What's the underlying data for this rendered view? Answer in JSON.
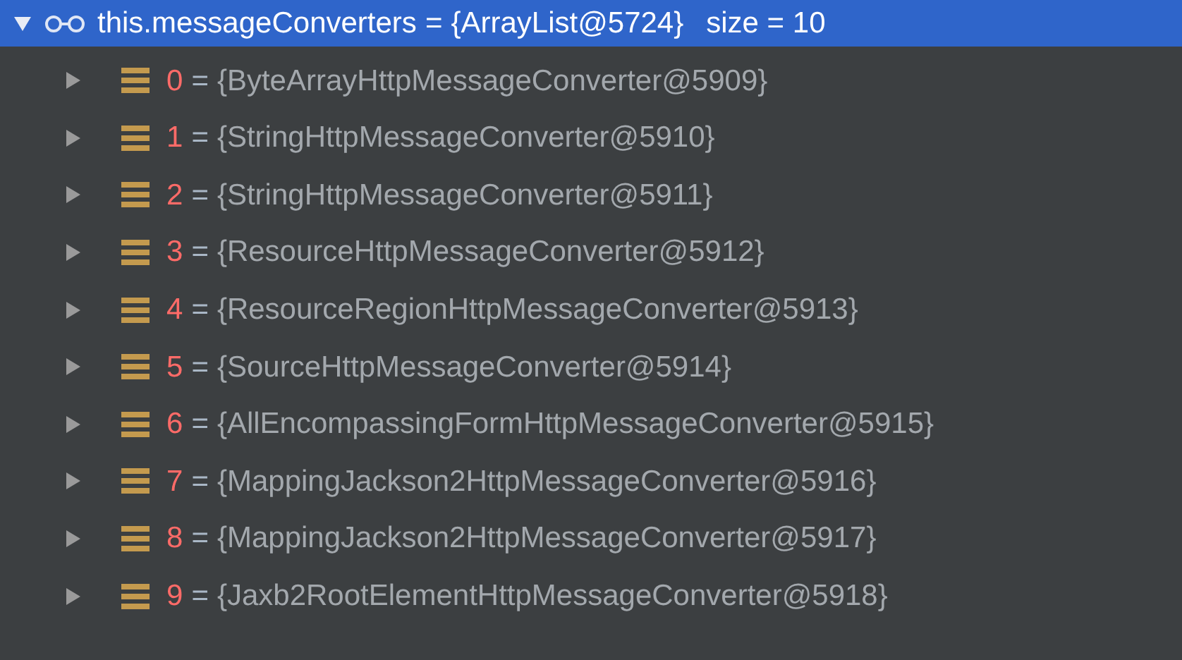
{
  "root": {
    "name": "this.messageConverters",
    "separator": "=",
    "value": "{ArrayList@5724}",
    "size": "size = 10",
    "expanded": true,
    "selected": true
  },
  "children": [
    {
      "index": "0",
      "separator": "=",
      "value": "{ByteArrayHttpMessageConverter@5909}",
      "expanded": false,
      "selected": false
    },
    {
      "index": "1",
      "separator": "=",
      "value": "{StringHttpMessageConverter@5910}",
      "expanded": false,
      "selected": false
    },
    {
      "index": "2",
      "separator": "=",
      "value": "{StringHttpMessageConverter@5911}",
      "expanded": false,
      "selected": false
    },
    {
      "index": "3",
      "separator": "=",
      "value": "{ResourceHttpMessageConverter@5912}",
      "expanded": false,
      "selected": false
    },
    {
      "index": "4",
      "separator": "=",
      "value": "{ResourceRegionHttpMessageConverter@5913}",
      "expanded": false,
      "selected": false
    },
    {
      "index": "5",
      "separator": "=",
      "value": "{SourceHttpMessageConverter@5914}",
      "expanded": false,
      "selected": false
    },
    {
      "index": "6",
      "separator": "=",
      "value": "{AllEncompassingFormHttpMessageConverter@5915}",
      "expanded": false,
      "selected": false
    },
    {
      "index": "7",
      "separator": "=",
      "value": "{MappingJackson2HttpMessageConverter@5916}",
      "expanded": false,
      "selected": false
    },
    {
      "index": "8",
      "separator": "=",
      "value": "{MappingJackson2HttpMessageConverter@5917}",
      "expanded": false,
      "selected": false
    },
    {
      "index": "9",
      "separator": "=",
      "value": "{Jaxb2RootElementHttpMessageConverter@5918}",
      "expanded": false,
      "selected": false
    }
  ]
}
